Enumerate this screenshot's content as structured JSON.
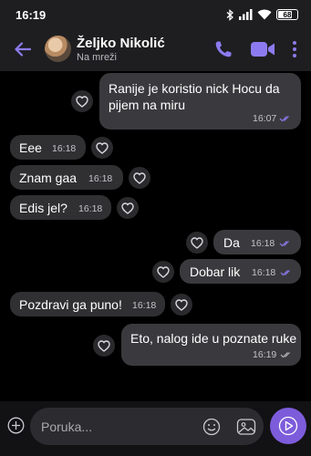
{
  "status_bar": {
    "time": "16:19",
    "battery": "68",
    "icons": [
      "bluetooth-icon",
      "signal-icon",
      "wifi-icon",
      "battery-icon"
    ]
  },
  "header": {
    "contact_name": "Željko Nikolić",
    "contact_status": "Na mreži",
    "icons": [
      "back-arrow-icon",
      "avatar",
      "phone-icon",
      "video-camera-icon",
      "more-vertical-icon"
    ]
  },
  "messages": [
    {
      "direction": "outgoing",
      "lines": [
        "Ranije je koristio nick Hocu da",
        "pijem na miru"
      ],
      "time": "16:07",
      "read": true
    },
    {
      "direction": "incoming",
      "lines": [
        "Eee"
      ],
      "time": "16:18"
    },
    {
      "direction": "incoming",
      "lines": [
        "Znam gaa"
      ],
      "time": "16:18"
    },
    {
      "direction": "incoming",
      "lines": [
        "Edis jel?"
      ],
      "time": "16:18"
    },
    {
      "direction": "outgoing",
      "lines": [
        "Da"
      ],
      "time": "16:18",
      "read": true
    },
    {
      "direction": "outgoing",
      "lines": [
        "Dobar lik"
      ],
      "time": "16:18",
      "read": true
    },
    {
      "direction": "incoming",
      "lines": [
        "Pozdravi ga puno!"
      ],
      "time": "16:18"
    },
    {
      "direction": "outgoing",
      "lines": [
        "Eto, nalog ide u poznate ruke"
      ],
      "time": "16:19",
      "read": false
    }
  ],
  "composer": {
    "placeholder": "Poruka...",
    "icons": [
      "plus-circle-icon",
      "emoji-icon",
      "sticker-icon",
      "send-icon"
    ]
  },
  "colors": {
    "accent": "#7d5cdb",
    "bubble_incoming": "#303033",
    "bubble_outgoing": "#3a3a3e",
    "read_tick": "#8c7bf0",
    "header_bg": "#1e1e20"
  }
}
